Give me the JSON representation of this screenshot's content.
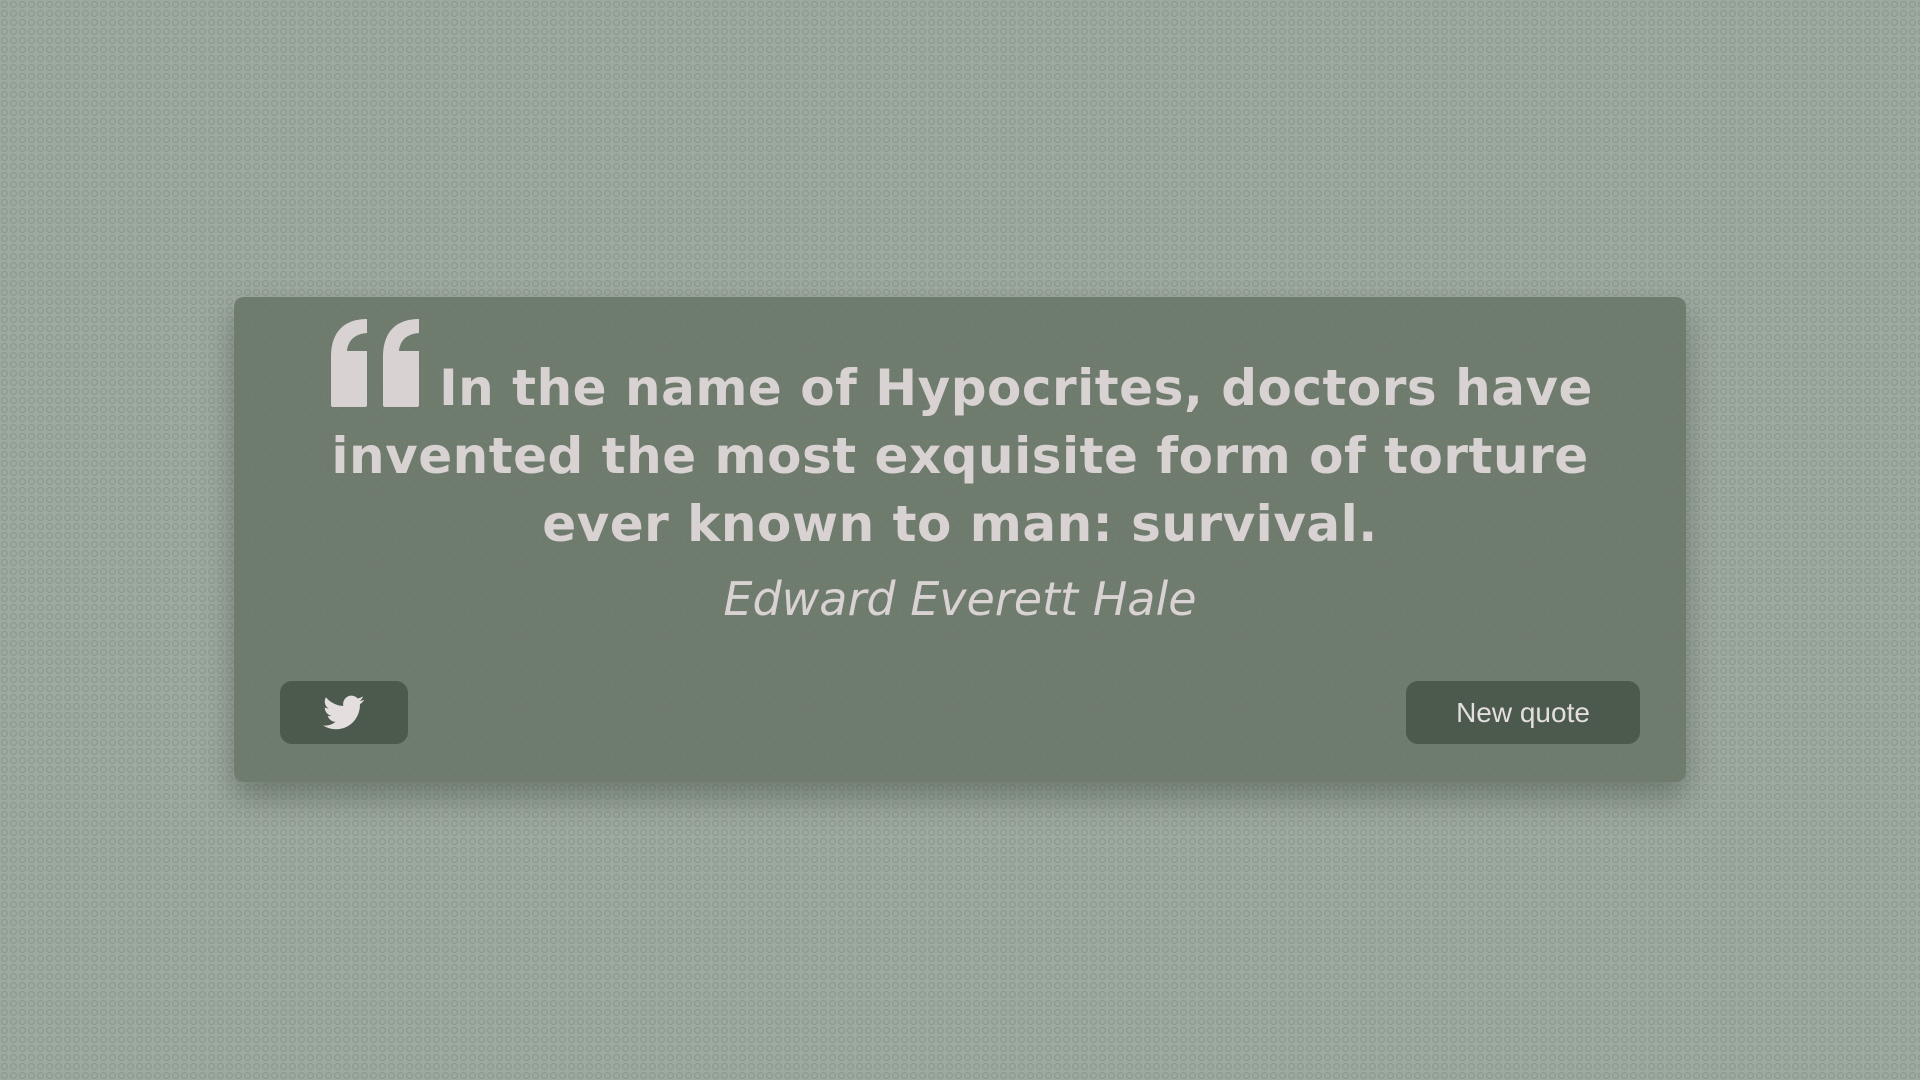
{
  "quote": {
    "text": "In the name of Hypocrites, doctors have invented the most exquisite form of torture ever known to man: survival.",
    "author": "Edward Everett Hale",
    "quote_icon": "quote-left-icon"
  },
  "actions": {
    "tweet_icon": "twitter-icon",
    "new_quote_label": "New quote"
  },
  "colors": {
    "background": "#9ea99f",
    "card": "#687467",
    "text": "#d9d2d2",
    "button": "#4b5a4c"
  }
}
